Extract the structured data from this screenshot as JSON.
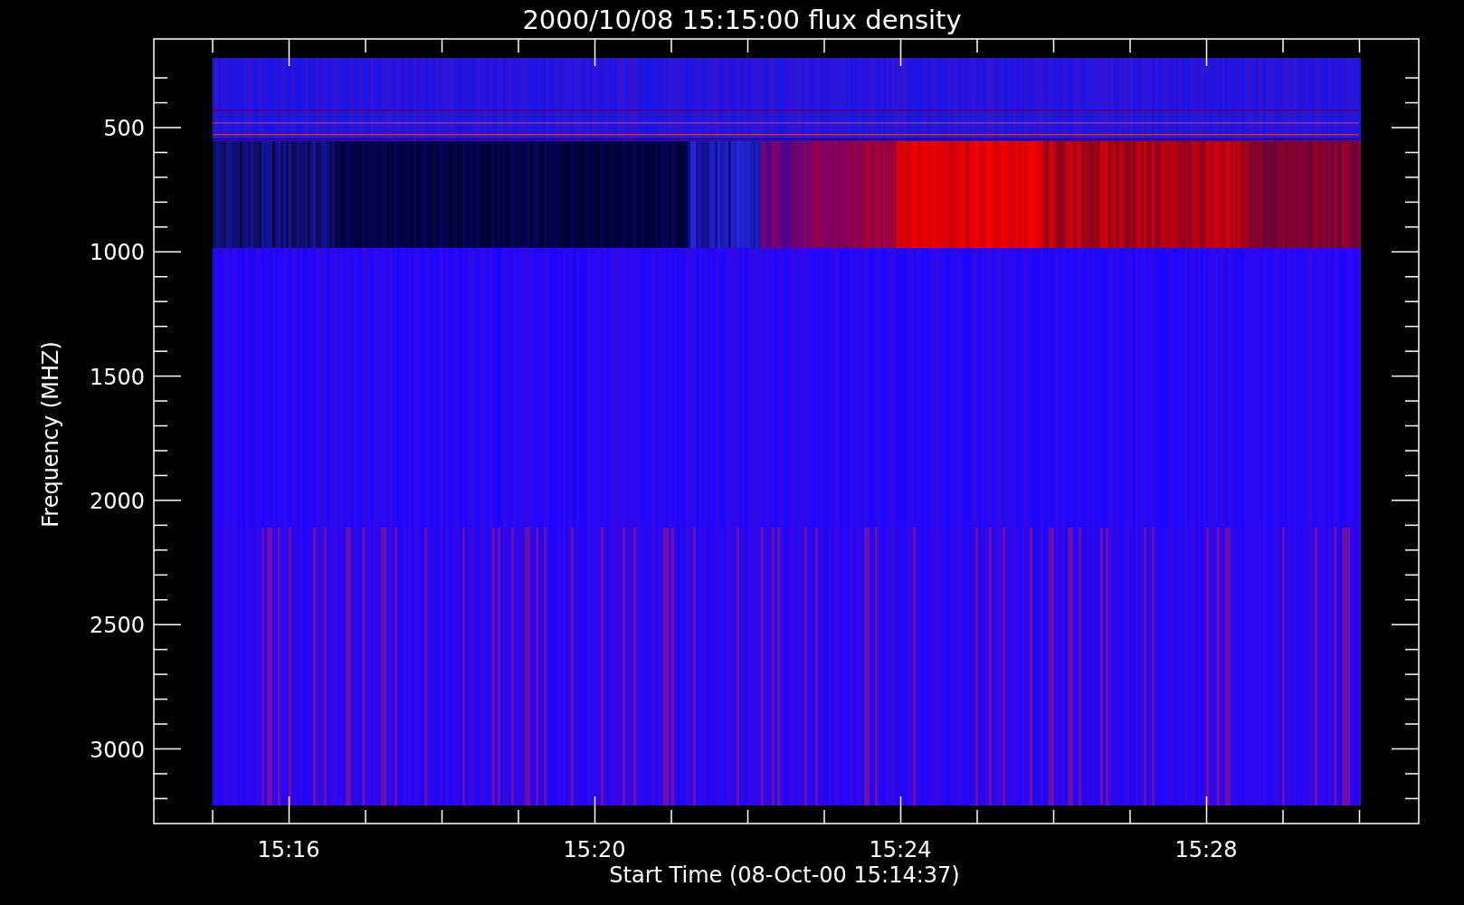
{
  "title": "2000/10/08 15:15:00 flux density",
  "y_axis": {
    "label": "Frequency (MHZ)",
    "ticks": [
      "500",
      "1000",
      "1500",
      "2000",
      "2500",
      "3000"
    ]
  },
  "x_axis": {
    "label": "Start Time (08-Oct-00 15:14:37)",
    "ticks": [
      "15:16",
      "15:20",
      "15:24",
      "15:28"
    ]
  }
}
